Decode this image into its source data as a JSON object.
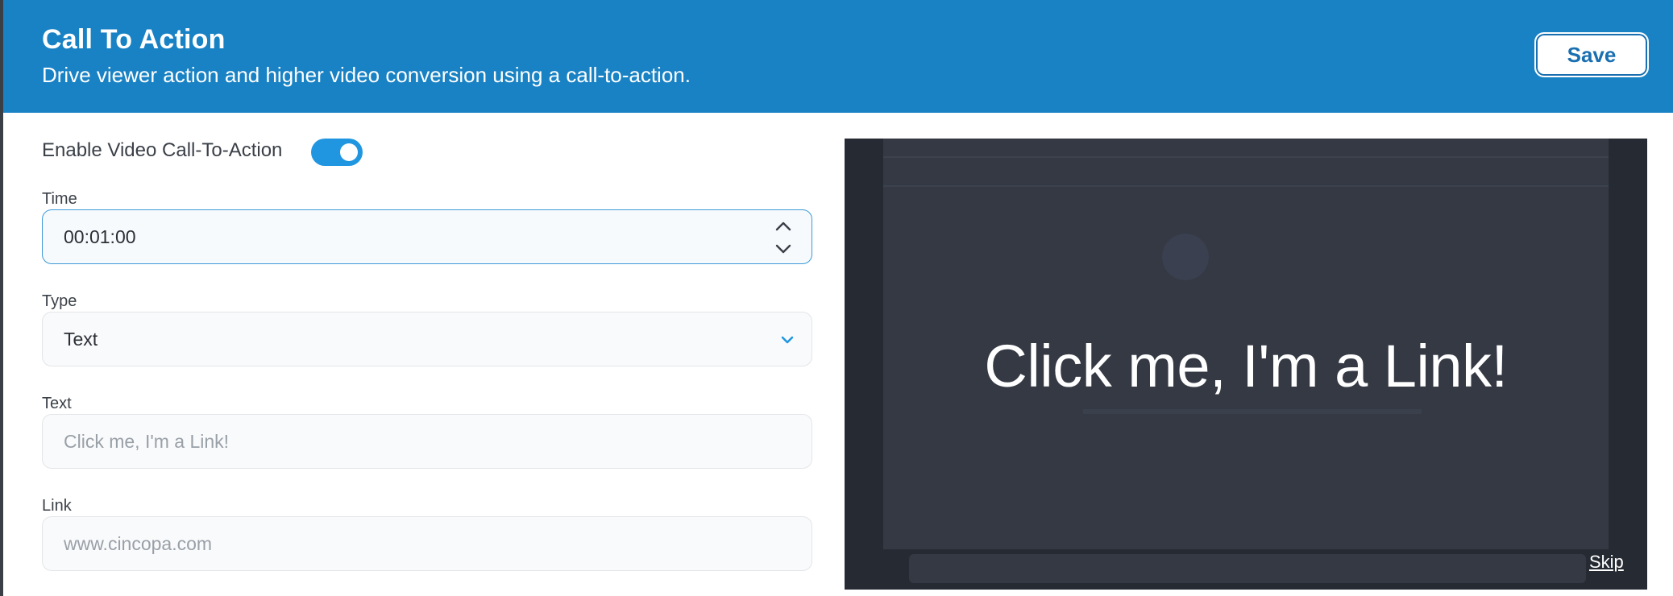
{
  "header": {
    "title": "Call To Action",
    "subtitle": "Drive viewer action and higher video conversion using a call-to-action.",
    "save_label": "Save"
  },
  "form": {
    "enable": {
      "label": "Enable Video Call-To-Action",
      "enabled": true
    },
    "time": {
      "label": "Time",
      "value": "00:01:00",
      "up_icon": "chevron-up-icon",
      "down_icon": "chevron-down-icon"
    },
    "type": {
      "label": "Type",
      "value": "Text",
      "icon": "chevron-down-icon"
    },
    "text": {
      "label": "Text",
      "placeholder": "Click me, I'm a Link!"
    },
    "link": {
      "label": "Link",
      "placeholder": "www.cincopa.com"
    }
  },
  "preview": {
    "cta_text": "Click me, I'm a Link!",
    "skip_label": "Skip"
  },
  "colors": {
    "header_bg": "#1982c4",
    "accent": "#2196e0",
    "preview_bg": "#262b33"
  }
}
